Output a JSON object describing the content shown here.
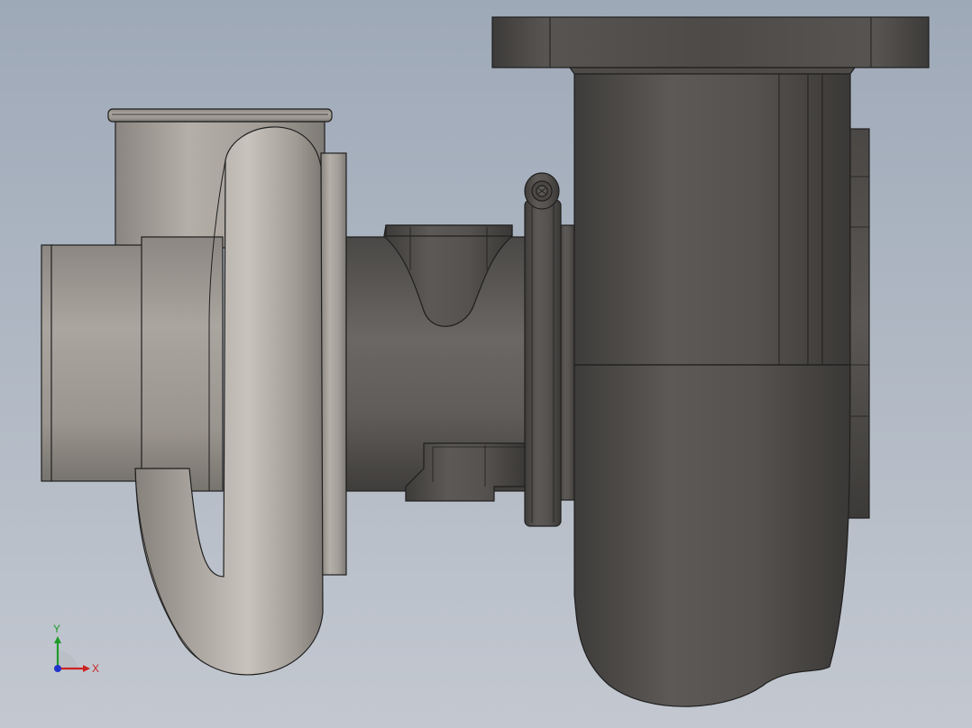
{
  "viewport": {
    "background_top": "#9ea9b8",
    "background_bottom": "#c2c7d0"
  },
  "model": {
    "compressor_color": "#a39e97",
    "turbine_color": "#55524f",
    "edge_color": "#1f1f1f"
  },
  "triad": {
    "x_label": "X",
    "y_label": "Y",
    "x_color": "#cc2222",
    "y_color": "#1f9a2a",
    "z_color": "#2233cc"
  }
}
